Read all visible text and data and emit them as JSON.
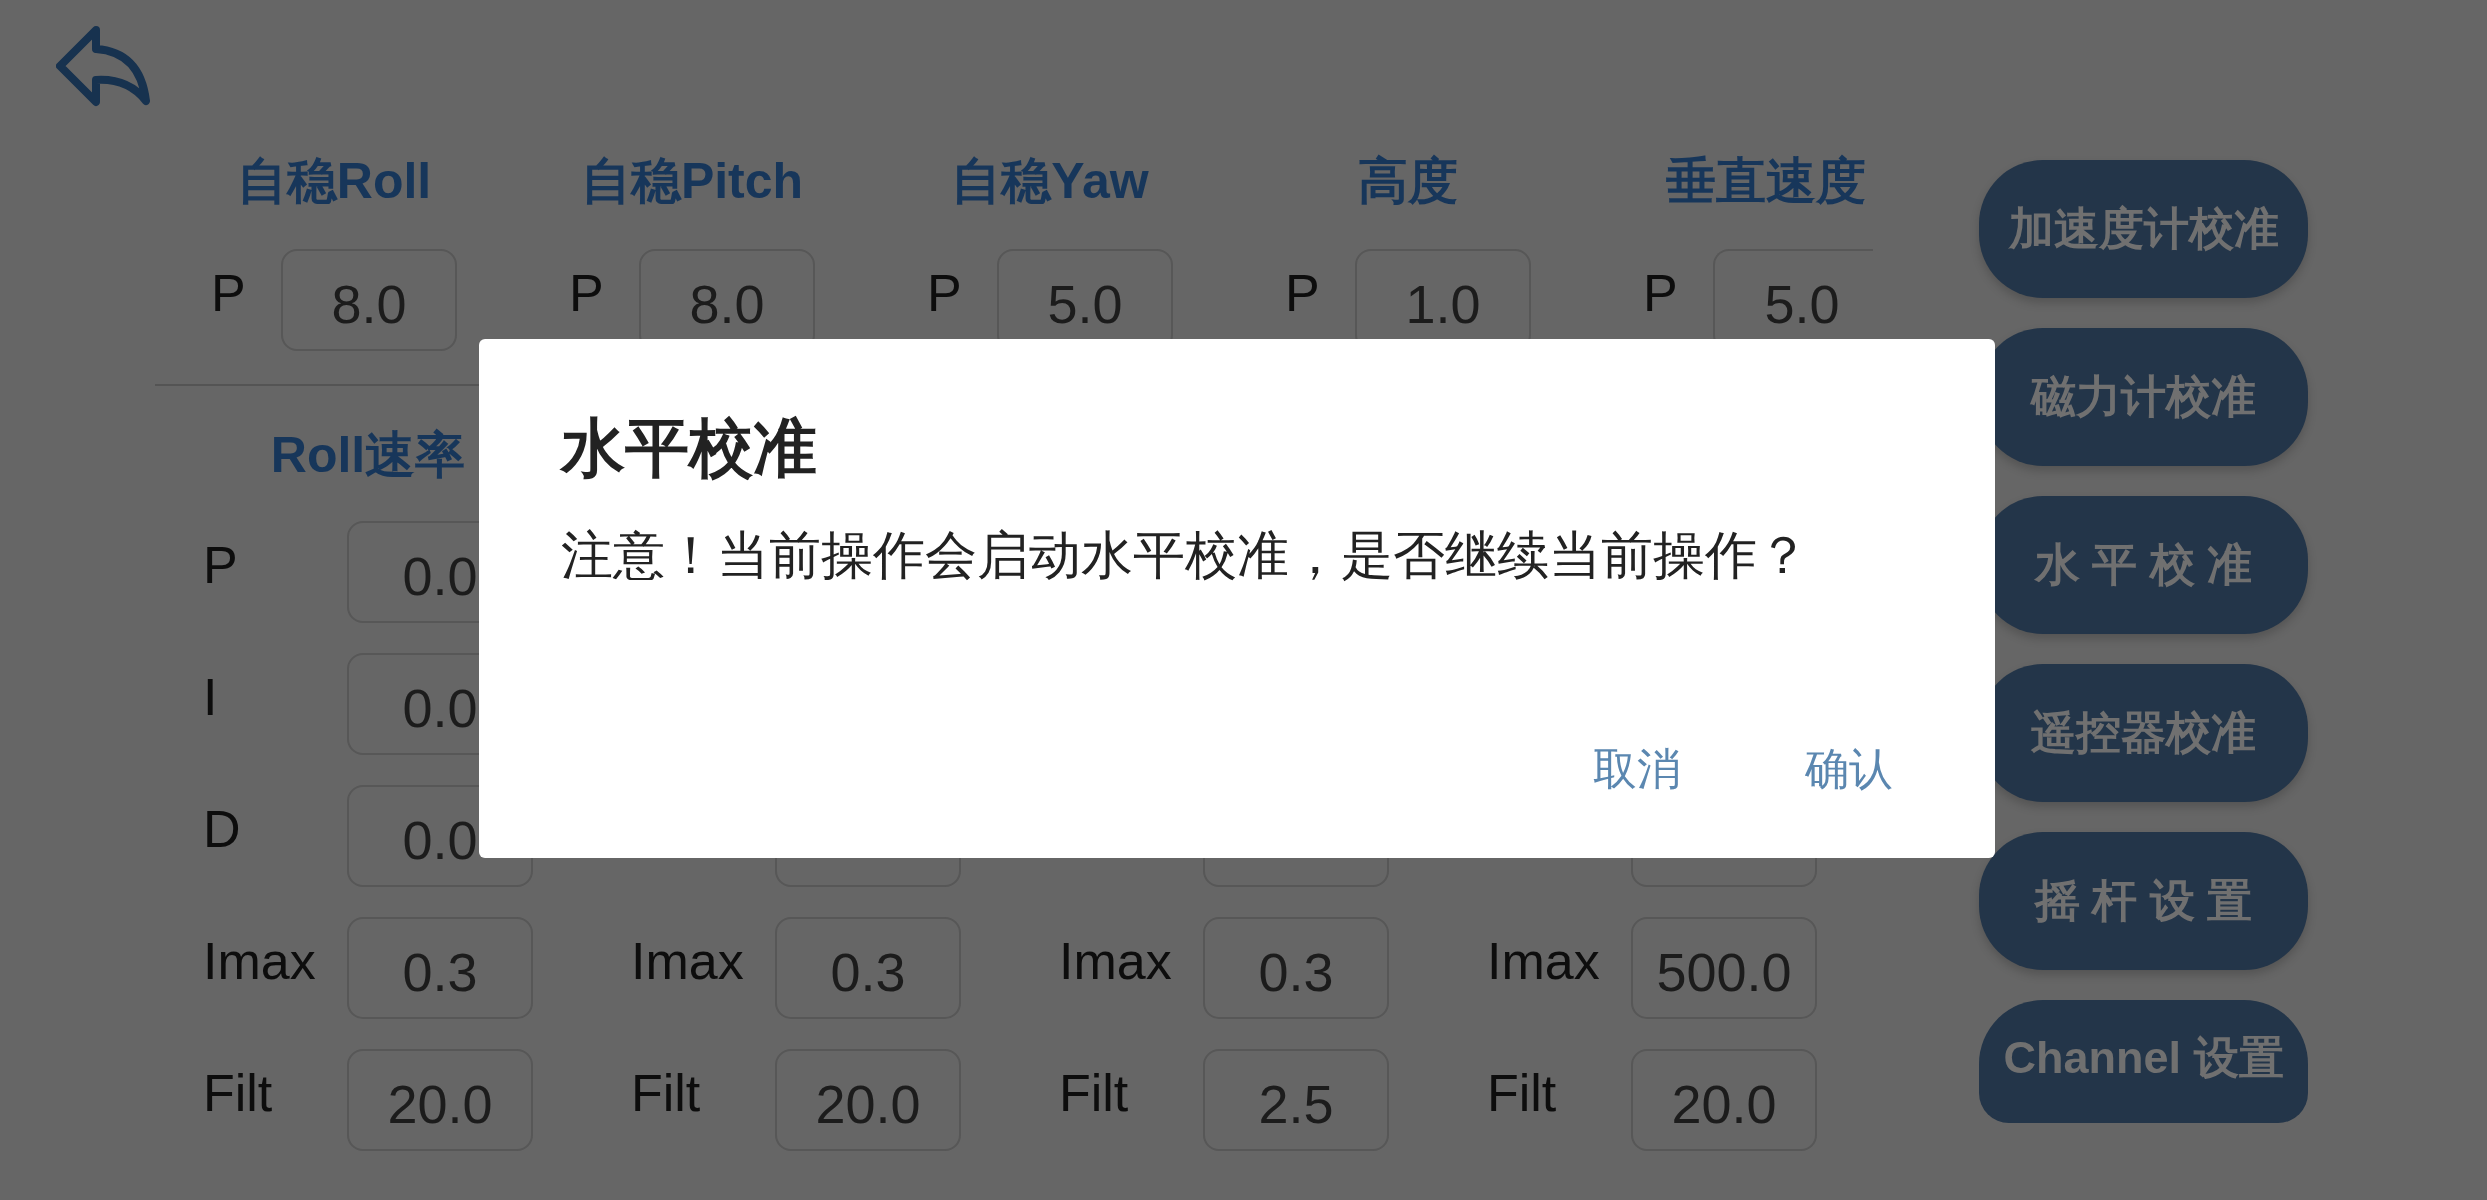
{
  "attitude": {
    "columns": [
      {
        "title": "自稳Roll",
        "params": [
          {
            "label": "P",
            "value": "8.0"
          }
        ]
      },
      {
        "title": "自稳Pitch",
        "params": [
          {
            "label": "P",
            "value": "8.0"
          }
        ]
      },
      {
        "title": "自稳Yaw",
        "params": [
          {
            "label": "P",
            "value": "5.0"
          }
        ]
      },
      {
        "title": "高度",
        "params": [
          {
            "label": "P",
            "value": "1.0"
          }
        ]
      },
      {
        "title": "垂直速度",
        "params": [
          {
            "label": "P",
            "value": "5.0"
          }
        ]
      }
    ]
  },
  "rate": {
    "columns": [
      {
        "title": "Roll速率",
        "params": [
          {
            "kind": "param",
            "label": "P",
            "value": "0.0"
          },
          {
            "kind": "param",
            "label": "I",
            "value": "0.0"
          },
          {
            "kind": "param",
            "label": "D",
            "value": "0.0"
          },
          {
            "kind": "param",
            "label": "Imax",
            "value": "0.3"
          },
          {
            "kind": "param",
            "label": "Filt",
            "value": "20.0"
          }
        ]
      },
      {
        "params": [
          {
            "kind": "field_edge"
          },
          {
            "kind": "param",
            "label": "Imax",
            "value": "0.3"
          },
          {
            "kind": "param",
            "label": "Filt",
            "value": "20.0"
          }
        ]
      },
      {
        "params": [
          {
            "kind": "field_edge"
          },
          {
            "kind": "param",
            "label": "Imax",
            "value": "0.3"
          },
          {
            "kind": "param",
            "label": "Filt",
            "value": "2.5"
          }
        ]
      },
      {
        "params": [
          {
            "kind": "field_edge"
          },
          {
            "kind": "param",
            "label": "Imax",
            "value": "500.0"
          },
          {
            "kind": "param",
            "label": "Filt",
            "value": "20.0"
          }
        ]
      }
    ]
  },
  "side_buttons": [
    "加速度计校准",
    "磁力计校准",
    "水 平 校 准",
    "遥控器校准",
    "摇 杆 设 置",
    "Channel 设置"
  ],
  "dialog": {
    "title": "水平校准",
    "message": "注意！当前操作会启动水平校准，是否继续当前操作？",
    "buttons": [
      "取消",
      "确认"
    ]
  }
}
